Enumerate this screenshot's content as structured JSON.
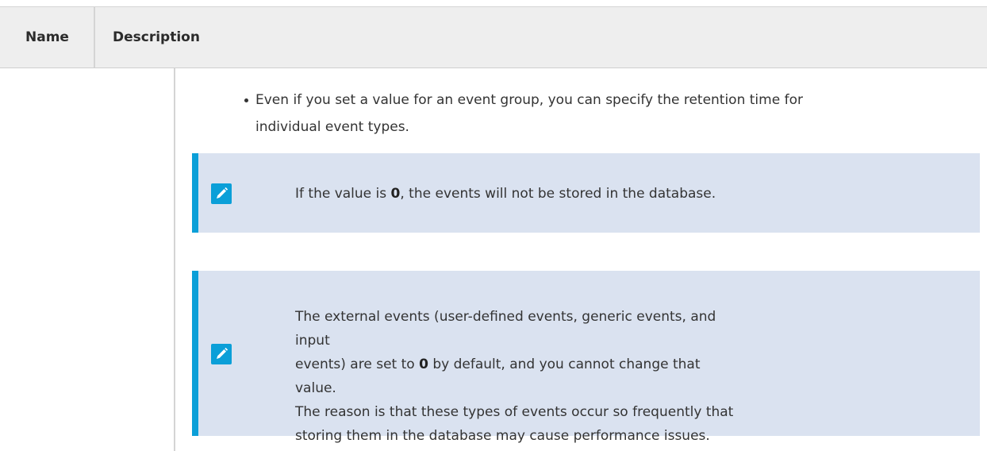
{
  "table": {
    "headers": {
      "name": "Name",
      "description": "Description"
    },
    "bullet": {
      "line1": "Even if you set a value for an event group, you can specify the retention time for",
      "line2": "individual event types."
    },
    "note1": {
      "icon": "pencil-note-icon",
      "text_before": "If the value is ",
      "bold": "0",
      "text_after": ", the events will not be stored in the database."
    },
    "note2": {
      "icon": "pencil-note-icon",
      "line1": "The external events (user-defined events, generic events, and input",
      "line2_before": "events) are set to ",
      "line2_bold": "0",
      "line2_after": " by default, and you cannot change that value.",
      "line3": "The reason is that these types of events occur so frequently that",
      "line4": "storing them in the database may cause performance issues."
    }
  },
  "colors": {
    "header_bg": "#eeeeee",
    "note_bg": "#dae2f0",
    "note_accent": "#0b9fd8"
  }
}
